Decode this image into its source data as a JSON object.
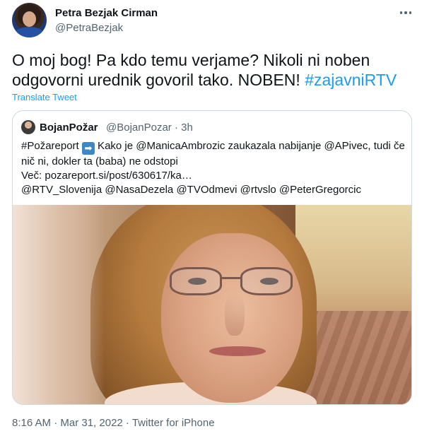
{
  "author": {
    "name": "Petra Bezjak Cirman",
    "handle": "@PetraBezjak"
  },
  "tweet": {
    "text": "O moj bog! Pa kdo temu verjame? Nikoli ni noben odgovorni urednik govoril tako. NOBEN! ",
    "hashtag": "#zajavniRTV",
    "translate_label": "Translate Tweet"
  },
  "quoted": {
    "name": "BojanPožar",
    "handle": "@BojanPozar",
    "time": "· 3h",
    "line1_tag": "#Požareport",
    "line1_rest": " Kako je @ManicaAmbrozic zaukazala nabijanje @APivec, tudi če",
    "line2": "nič ni, dokler ta (baba) ne odstopi",
    "line3": "Več: pozareport.si/post/630617/ka…",
    "line4": "@RTV_Slovenija @NasaDezela @TVOdmevi @rtvslo @PeterGregorcic",
    "arrow_emoji": "➡"
  },
  "footer": {
    "time": "8:16 AM · Mar 31, 2022 · ",
    "source": "Twitter for iPhone"
  },
  "icons": {
    "more": "more-horizontal-icon"
  },
  "colors": {
    "link": "#1d9bf0",
    "secondary_text": "#536471",
    "border": "#cfd9de"
  }
}
